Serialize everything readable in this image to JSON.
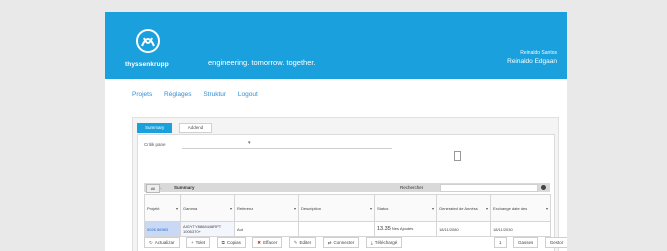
{
  "header": {
    "brand": "thyssenkrupp",
    "tagline": "engineering. tomorrow. together.",
    "user_name": "Reinaldo Santos",
    "user_role": "Reinaldo Edgaan",
    "colors": {
      "header_bg": "#1aa1dd",
      "accent": "#1aa1dd"
    },
    "logo_icon": "thyssenkrupp-logo"
  },
  "nav": {
    "items": [
      {
        "label": "Projets"
      },
      {
        "label": "Réglages"
      },
      {
        "label": "Struktur"
      },
      {
        "label": "Logout"
      }
    ]
  },
  "tabs": [
    {
      "label": "Summary",
      "active": true
    },
    {
      "label": "Addend",
      "active": false
    }
  ],
  "filter": {
    "label": "Critik pane",
    "selected_value": "",
    "icon": "filter-icon"
  },
  "grid": {
    "toolbar": {
      "page_size_label": "All Item",
      "page_size_mid": "..",
      "title": "Summary",
      "search_label": "Rechercher",
      "options_icon": "dot-icon"
    },
    "columns": [
      {
        "label": "Projekt"
      },
      {
        "label": "Gamma"
      },
      {
        "label": "Referenz"
      },
      {
        "label": "Description"
      },
      {
        "label": "Status"
      },
      {
        "label": "Generated de Annéss"
      },
      {
        "label": "Exchange date des"
      }
    ],
    "rows": [
      {
        "project": "0026 86983",
        "gamma": "AIGYTY8868448RPT 1006370+",
        "reference": "Aut",
        "description": "",
        "status": "13.35",
        "status_note": "Nes Ajoutés",
        "generated": "18/11/2080",
        "exchange": "18/11/2030"
      }
    ]
  },
  "actions": [
    {
      "label": "Actualizar",
      "icon": "refresh-icon"
    },
    {
      "label": "Tolet",
      "icon": "plus-icon"
    },
    {
      "label": "Copias",
      "icon": "copy-icon"
    },
    {
      "label": "Effacer",
      "icon": "close-icon"
    },
    {
      "label": "Editer",
      "icon": "edit-icon"
    },
    {
      "label": "Connecter",
      "icon": "connect-icon"
    },
    {
      "label": "Téléchargé",
      "icon": "download-icon"
    }
  ],
  "actions_right": [
    {
      "label": "1"
    },
    {
      "label": "Gasses"
    },
    {
      "label": "Gestor"
    }
  ]
}
